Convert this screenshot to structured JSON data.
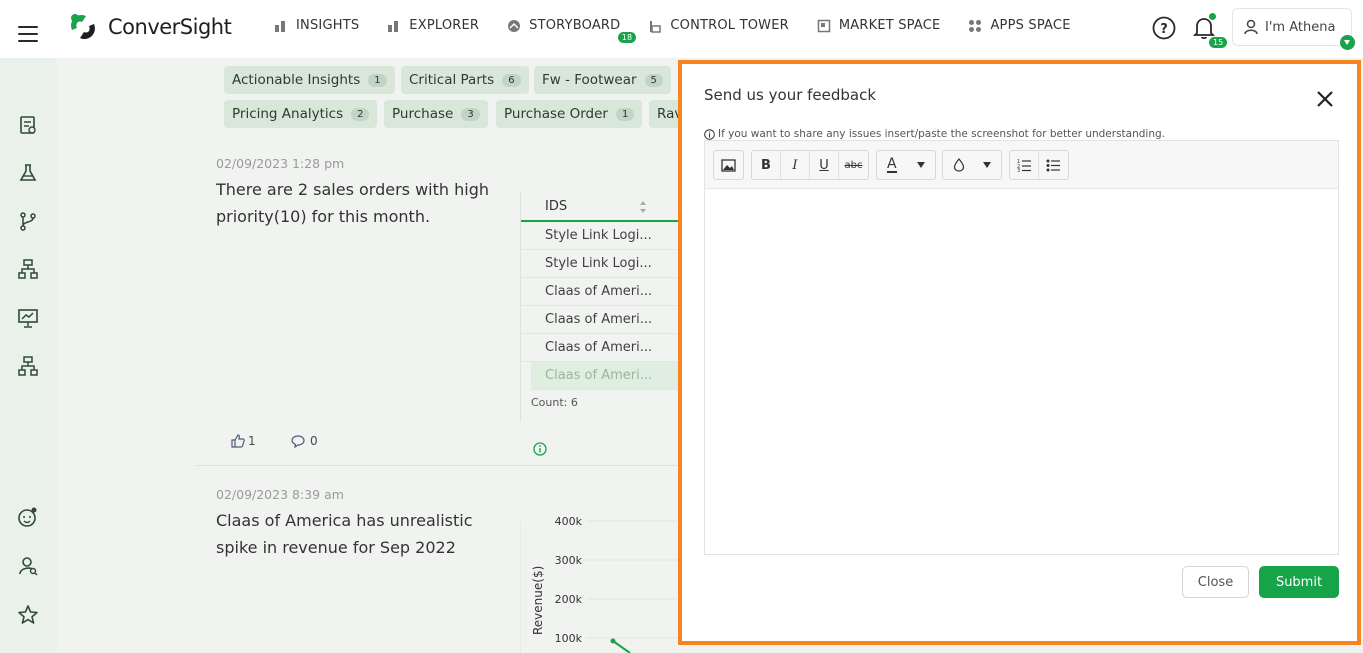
{
  "header": {
    "brand": "ConverSight",
    "nav": [
      {
        "label": "INSIGHTS",
        "icon": "bar-chart-icon"
      },
      {
        "label": "EXPLORER",
        "icon": "bar-chart-icon"
      },
      {
        "label": "STORYBOARD",
        "icon": "storyboard-icon",
        "badge": "18"
      },
      {
        "label": "CONTROL TOWER",
        "icon": "tower-icon"
      },
      {
        "label": "MARKET SPACE",
        "icon": "market-icon"
      },
      {
        "label": "APPS SPACE",
        "icon": "apps-icon"
      }
    ],
    "notification_count": "15",
    "user_label": "I'm Athena"
  },
  "sidebar": {
    "icons": [
      "insights-list-icon",
      "flask-icon",
      "branch-icon",
      "hierarchy-icon",
      "presentation-icon",
      "org-chart-icon",
      "baby-face-icon",
      "user-search-icon",
      "star-icon"
    ]
  },
  "chips": [
    {
      "label": "Actionable Insights",
      "count": "1"
    },
    {
      "label": "Critical Parts",
      "count": "6"
    },
    {
      "label": "Fw - Footwear",
      "count": "5"
    },
    {
      "label": "Pricing Analytics",
      "count": "2"
    },
    {
      "label": "Purchase",
      "count": "3"
    },
    {
      "label": "Purchase Order",
      "count": "1"
    },
    {
      "label": "Rav",
      "count": ""
    }
  ],
  "feed": [
    {
      "date": "02/09/2023 1:28 pm",
      "text": "There are 2 sales orders with high priority(10) for this month.",
      "table": {
        "header": "IDS",
        "rows": [
          "Style Link Logi...",
          "Style Link Logi...",
          "Claas of Ameri...",
          "Claas of Ameri...",
          "Claas of Ameri...",
          "Claas of Ameri..."
        ],
        "count": "Count: 6"
      },
      "likes": "1",
      "comments": "0"
    },
    {
      "date": "02/09/2023 8:39 am",
      "text": "Claas of America has unrealistic spike in revenue for Sep 2022"
    }
  ],
  "chart_data": {
    "type": "line",
    "ylabel": "Revenue($)",
    "y_ticks": [
      "400k",
      "300k",
      "200k",
      "100k"
    ],
    "ylim": [
      0,
      400000
    ],
    "points": [
      {
        "x": 0,
        "y": 100000
      }
    ]
  },
  "modal": {
    "title": "Send us your feedback",
    "info": "If you want to share any issues insert/paste the screenshot for better understanding.",
    "toolbar": {
      "bold": "B",
      "italic": "I",
      "underline": "U",
      "strike": "abc",
      "font_color": "A"
    },
    "close_label": "Close",
    "submit_label": "Submit",
    "border_color": "#f7841f",
    "accent_color": "#16a34a"
  }
}
